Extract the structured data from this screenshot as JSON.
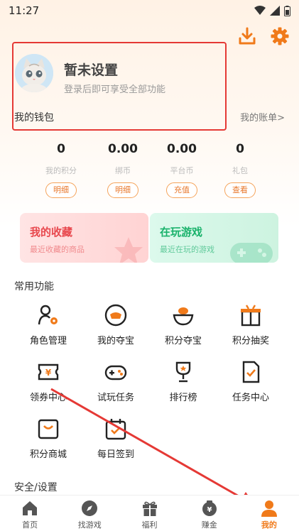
{
  "status": {
    "time": "11:27"
  },
  "profile": {
    "name": "暂未设置",
    "subtitle": "登录后即可享受全部功能"
  },
  "wallet": {
    "title": "我的钱包",
    "link": "我的账单>",
    "stats": [
      {
        "value": "0",
        "label": "我的积分",
        "button": "明细"
      },
      {
        "value": "0.00",
        "label": "绑币",
        "button": "明细"
      },
      {
        "value": "0.00",
        "label": "平台币",
        "button": "充值"
      },
      {
        "value": "0",
        "label": "礼包",
        "button": "查看"
      }
    ]
  },
  "cards": {
    "favorites": {
      "title": "我的收藏",
      "subtitle": "最近收藏的商品"
    },
    "playing": {
      "title": "在玩游戏",
      "subtitle": "最近在玩的游戏"
    }
  },
  "functions": {
    "title": "常用功能",
    "items": [
      {
        "label": "角色管理",
        "icon": "role-manage-icon"
      },
      {
        "label": "我的夺宝",
        "icon": "my-treasure-icon"
      },
      {
        "label": "积分夺宝",
        "icon": "points-treasure-icon"
      },
      {
        "label": "积分抽奖",
        "icon": "points-lottery-icon"
      },
      {
        "label": "领券中心",
        "icon": "coupon-center-icon"
      },
      {
        "label": "试玩任务",
        "icon": "trial-task-icon"
      },
      {
        "label": "排行榜",
        "icon": "ranking-icon"
      },
      {
        "label": "任务中心",
        "icon": "task-center-icon"
      },
      {
        "label": "积分商城",
        "icon": "points-mall-icon"
      },
      {
        "label": "每日签到",
        "icon": "daily-checkin-icon"
      }
    ]
  },
  "security": {
    "title": "安全/设置"
  },
  "tabbar": {
    "items": [
      {
        "label": "首页",
        "icon": "home-icon"
      },
      {
        "label": "找游戏",
        "icon": "compass-icon"
      },
      {
        "label": "福利",
        "icon": "gift-icon"
      },
      {
        "label": "赚金",
        "icon": "money-bag-icon"
      },
      {
        "label": "我的",
        "icon": "user-icon"
      }
    ],
    "active": "我的"
  },
  "colors": {
    "accent": "#f07a1a",
    "highlight_box": "#e53935",
    "favorites": "#e8474d",
    "playing": "#19b26b"
  }
}
